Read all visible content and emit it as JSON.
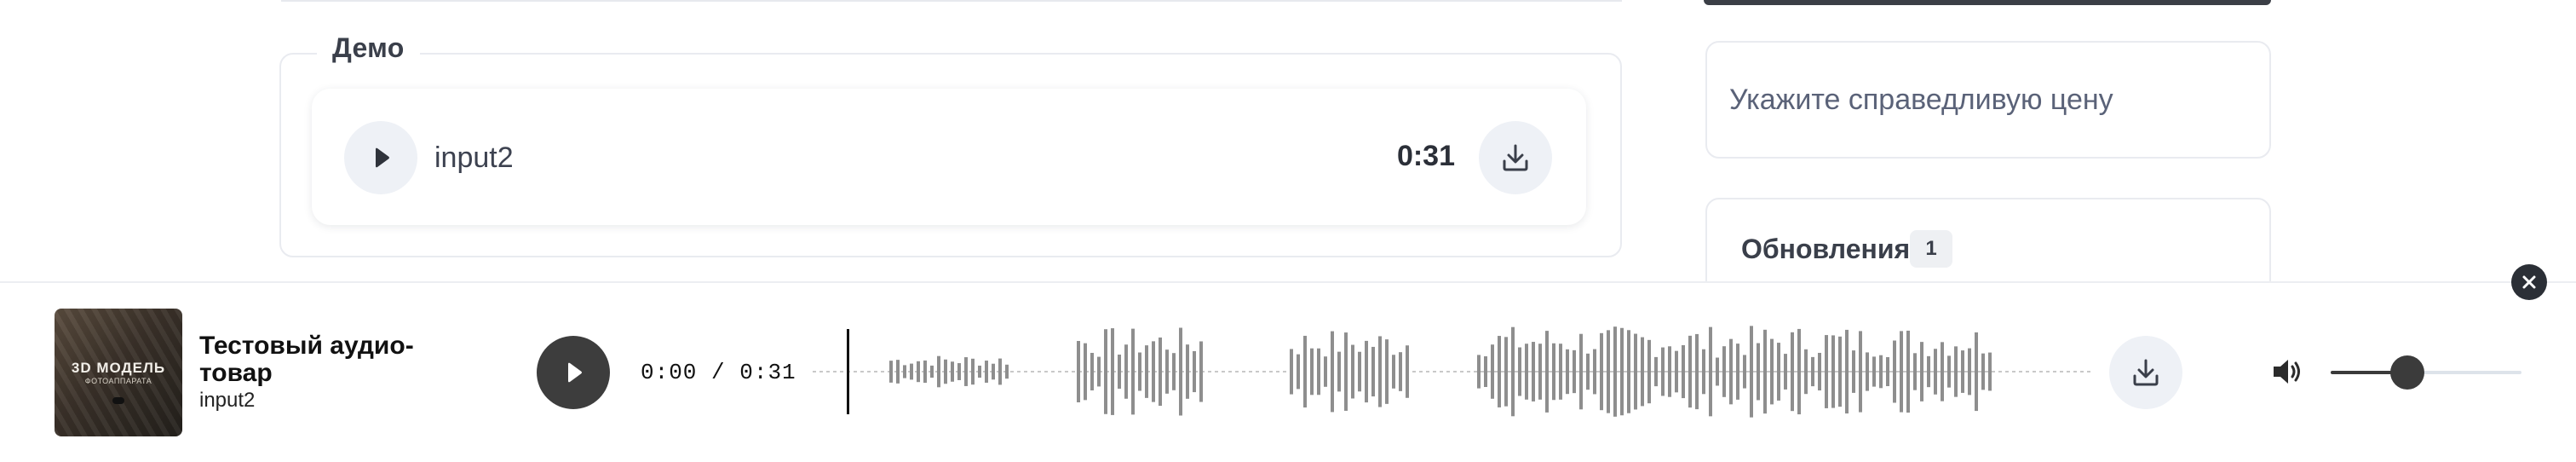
{
  "demo": {
    "legend": "Демо",
    "track": {
      "name": "input2",
      "duration": "0:31"
    }
  },
  "sidebar": {
    "price_prompt": "Укажите справедливую цену",
    "updates_title": "Обновления",
    "updates_count": "1"
  },
  "player": {
    "title": "Тестовый аудио-товар",
    "subtitle": "input2",
    "current_time": "0:00",
    "separator": " / ",
    "total_time": "0:31",
    "volume_level": 0.4,
    "progress": 0,
    "cover": {
      "title": "3D МОДЕЛЬ",
      "subtitle": "ФОТОАППАРАТА"
    }
  },
  "colors": {
    "waveform": "#8e8e8e",
    "playhead": "#111111",
    "accent_dark": "#3d3d3d"
  },
  "icons": [
    "play-icon",
    "download-icon",
    "close-icon",
    "volume-icon"
  ]
}
